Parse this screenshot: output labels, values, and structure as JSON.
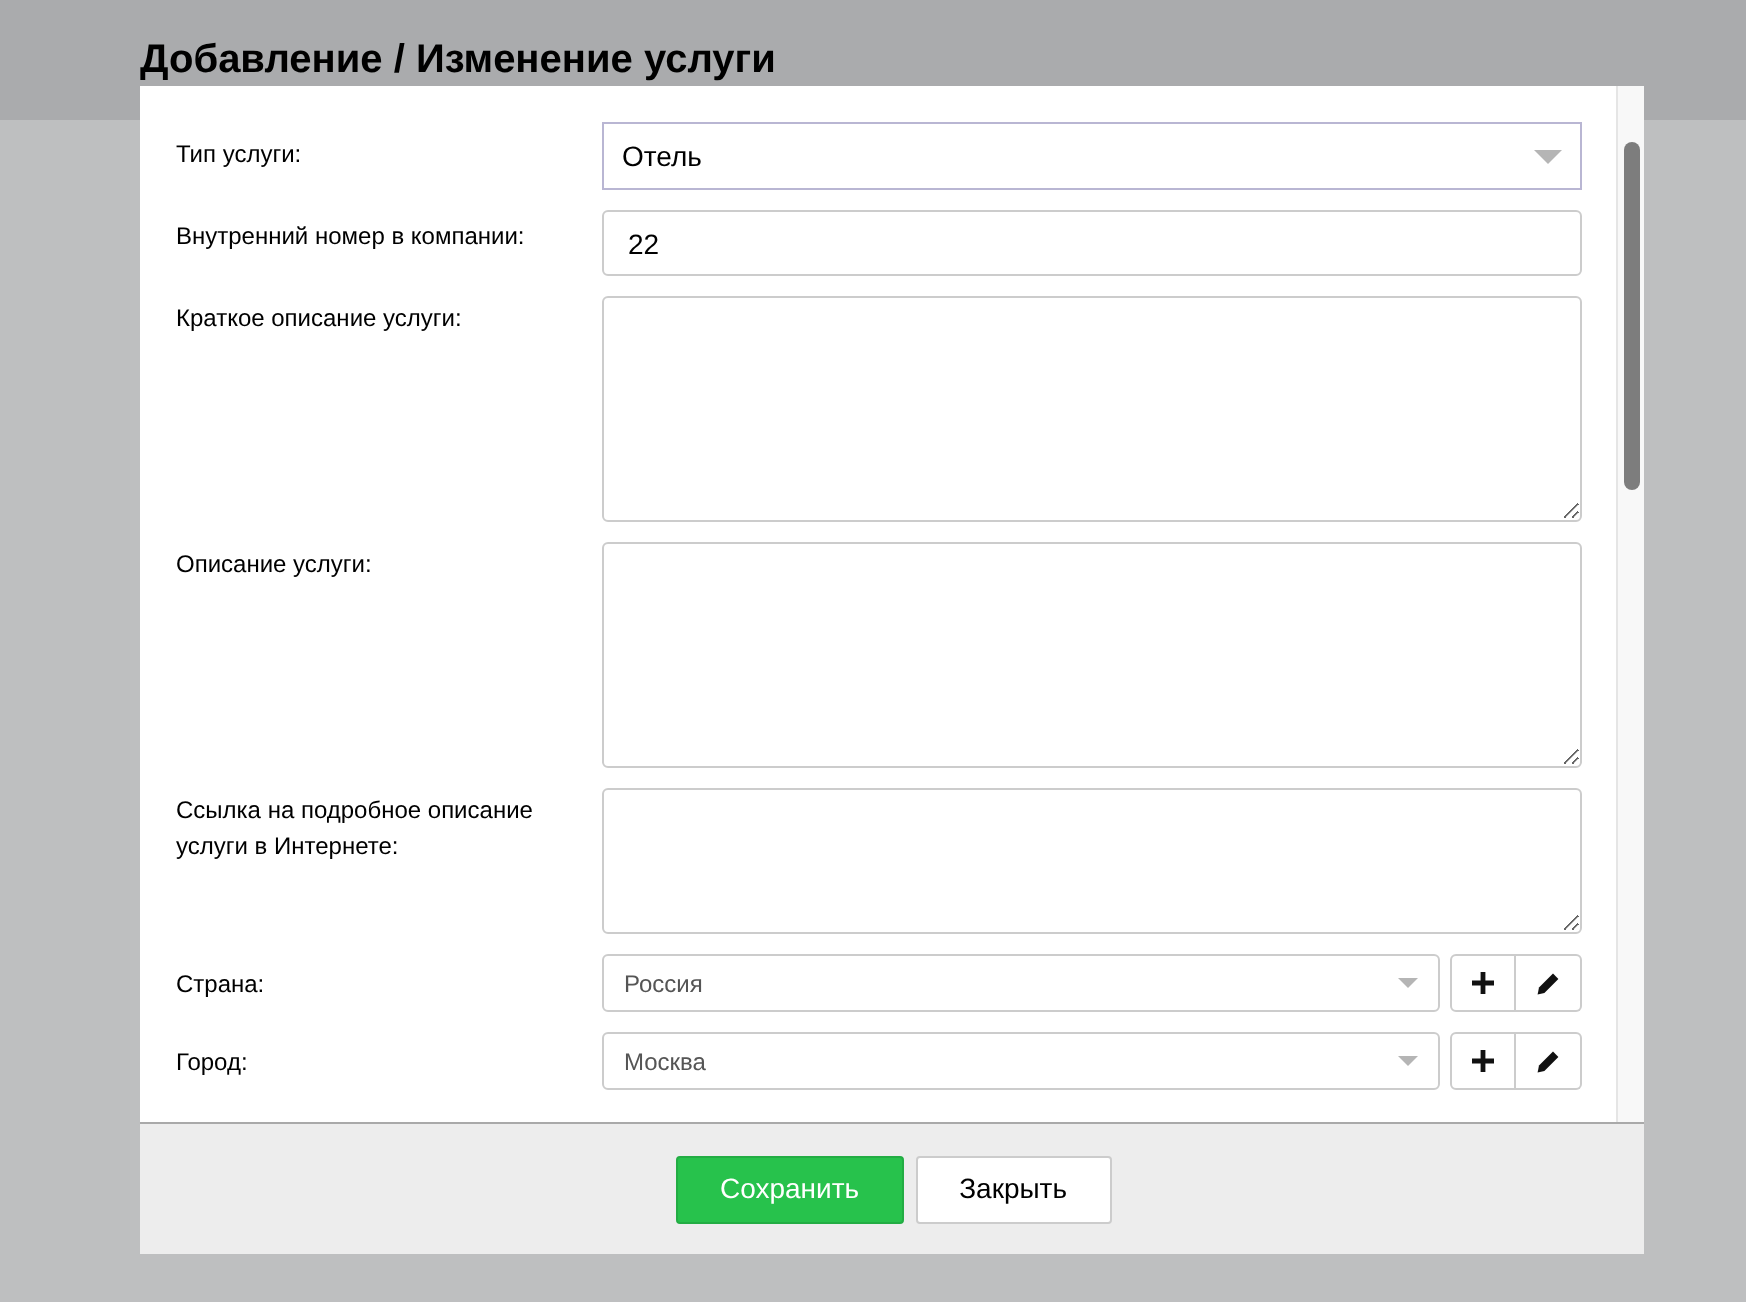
{
  "dialog": {
    "title": "Добавление / Изменение услуги",
    "fields": [
      {
        "kind": "select",
        "label": "Тип услуги:",
        "value": "Отель"
      },
      {
        "kind": "input",
        "label": "Внутренний номер в компании:",
        "value": "22"
      },
      {
        "kind": "textarea",
        "label": "Краткое описание услуги:"
      },
      {
        "kind": "textarea",
        "label": "Описание услуги:"
      },
      {
        "kind": "short_textarea",
        "label": "Ссылка на подробное описание услуги в Интернете:"
      },
      {
        "kind": "combo",
        "label": "Страна:",
        "value": "Россия"
      },
      {
        "kind": "combo",
        "label": "Город:",
        "value": "Москва"
      }
    ],
    "buttons": [
      {
        "kind": "primary",
        "label": "Сохранить"
      },
      {
        "kind": "secondary",
        "label": "Закрыть"
      }
    ]
  }
}
